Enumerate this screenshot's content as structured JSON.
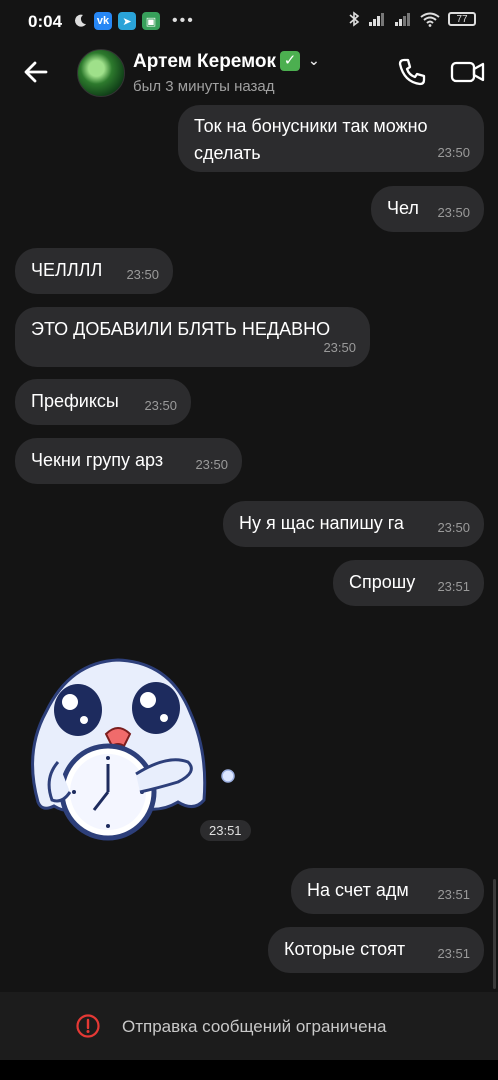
{
  "status_bar": {
    "time": "0:04",
    "battery": "77",
    "left_icons": [
      "moon-icon",
      "vk-icon",
      "telegram-icon",
      "app-icon",
      "more-dots-icon"
    ],
    "right_icons": [
      "bluetooth-icon",
      "signal-icon",
      "signal-icon",
      "wifi-icon",
      "battery-icon"
    ]
  },
  "header": {
    "name": "Артем Керемок",
    "verified_mark": "✓",
    "status": "был 3 минуты назад",
    "accent": "#4caf50"
  },
  "messages": [
    {
      "side": "out",
      "text": "Ток на бонусники так можно сделать",
      "time": "23:50"
    },
    {
      "side": "out",
      "text": "Чел",
      "time": "23:50"
    },
    {
      "side": "in",
      "text": "ЧЕЛЛЛЛ",
      "time": "23:50"
    },
    {
      "side": "in",
      "text": "ЭТО ДОБАВИЛИ БЛЯТЬ НЕДАВНО",
      "time": "23:50"
    },
    {
      "side": "in",
      "text": "Префиксы",
      "time": "23:50"
    },
    {
      "side": "in",
      "text": "Чекни групу арз",
      "time": "23:50"
    },
    {
      "side": "out",
      "text": "Ну я щас напишу га",
      "time": "23:50"
    },
    {
      "side": "out",
      "text": "Спрошу",
      "time": "23:51"
    },
    {
      "side": "in",
      "type": "sticker",
      "sticker": "ghost-with-clock-sticker",
      "time": "23:51"
    },
    {
      "side": "out",
      "text": "На счет адм",
      "time": "23:51"
    },
    {
      "side": "out",
      "text": "Которые стоят",
      "time": "23:51"
    }
  ],
  "bottom_bar": {
    "restriction_text": "Отправка сообщений ограничена",
    "warn_color": "#e53935"
  },
  "colors": {
    "background": "#141414",
    "bubble": "#2c2c2e",
    "time_text": "#9a9a9a"
  }
}
